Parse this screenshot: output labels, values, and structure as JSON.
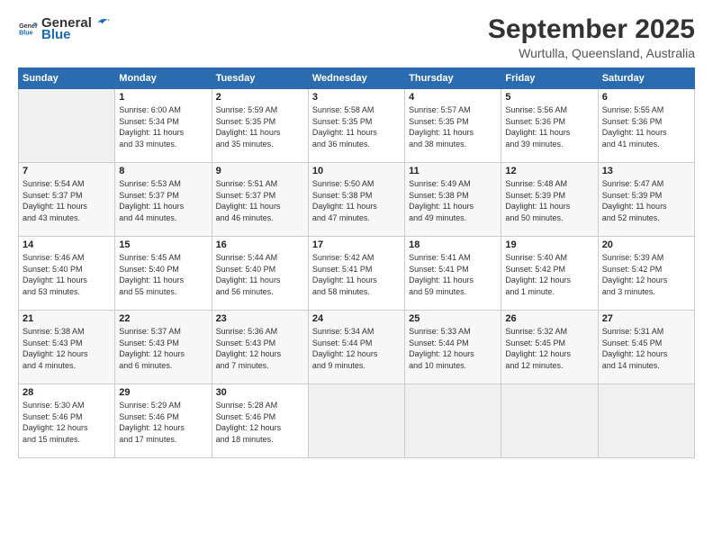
{
  "header": {
    "logo_line1": "General",
    "logo_line2": "Blue",
    "month": "September 2025",
    "location": "Wurtulla, Queensland, Australia"
  },
  "weekdays": [
    "Sunday",
    "Monday",
    "Tuesday",
    "Wednesday",
    "Thursday",
    "Friday",
    "Saturday"
  ],
  "weeks": [
    [
      {
        "day": "",
        "info": ""
      },
      {
        "day": "1",
        "info": "Sunrise: 6:00 AM\nSunset: 5:34 PM\nDaylight: 11 hours\nand 33 minutes."
      },
      {
        "day": "2",
        "info": "Sunrise: 5:59 AM\nSunset: 5:35 PM\nDaylight: 11 hours\nand 35 minutes."
      },
      {
        "day": "3",
        "info": "Sunrise: 5:58 AM\nSunset: 5:35 PM\nDaylight: 11 hours\nand 36 minutes."
      },
      {
        "day": "4",
        "info": "Sunrise: 5:57 AM\nSunset: 5:35 PM\nDaylight: 11 hours\nand 38 minutes."
      },
      {
        "day": "5",
        "info": "Sunrise: 5:56 AM\nSunset: 5:36 PM\nDaylight: 11 hours\nand 39 minutes."
      },
      {
        "day": "6",
        "info": "Sunrise: 5:55 AM\nSunset: 5:36 PM\nDaylight: 11 hours\nand 41 minutes."
      }
    ],
    [
      {
        "day": "7",
        "info": "Sunrise: 5:54 AM\nSunset: 5:37 PM\nDaylight: 11 hours\nand 43 minutes."
      },
      {
        "day": "8",
        "info": "Sunrise: 5:53 AM\nSunset: 5:37 PM\nDaylight: 11 hours\nand 44 minutes."
      },
      {
        "day": "9",
        "info": "Sunrise: 5:51 AM\nSunset: 5:37 PM\nDaylight: 11 hours\nand 46 minutes."
      },
      {
        "day": "10",
        "info": "Sunrise: 5:50 AM\nSunset: 5:38 PM\nDaylight: 11 hours\nand 47 minutes."
      },
      {
        "day": "11",
        "info": "Sunrise: 5:49 AM\nSunset: 5:38 PM\nDaylight: 11 hours\nand 49 minutes."
      },
      {
        "day": "12",
        "info": "Sunrise: 5:48 AM\nSunset: 5:39 PM\nDaylight: 11 hours\nand 50 minutes."
      },
      {
        "day": "13",
        "info": "Sunrise: 5:47 AM\nSunset: 5:39 PM\nDaylight: 11 hours\nand 52 minutes."
      }
    ],
    [
      {
        "day": "14",
        "info": "Sunrise: 5:46 AM\nSunset: 5:40 PM\nDaylight: 11 hours\nand 53 minutes."
      },
      {
        "day": "15",
        "info": "Sunrise: 5:45 AM\nSunset: 5:40 PM\nDaylight: 11 hours\nand 55 minutes."
      },
      {
        "day": "16",
        "info": "Sunrise: 5:44 AM\nSunset: 5:40 PM\nDaylight: 11 hours\nand 56 minutes."
      },
      {
        "day": "17",
        "info": "Sunrise: 5:42 AM\nSunset: 5:41 PM\nDaylight: 11 hours\nand 58 minutes."
      },
      {
        "day": "18",
        "info": "Sunrise: 5:41 AM\nSunset: 5:41 PM\nDaylight: 11 hours\nand 59 minutes."
      },
      {
        "day": "19",
        "info": "Sunrise: 5:40 AM\nSunset: 5:42 PM\nDaylight: 12 hours\nand 1 minute."
      },
      {
        "day": "20",
        "info": "Sunrise: 5:39 AM\nSunset: 5:42 PM\nDaylight: 12 hours\nand 3 minutes."
      }
    ],
    [
      {
        "day": "21",
        "info": "Sunrise: 5:38 AM\nSunset: 5:43 PM\nDaylight: 12 hours\nand 4 minutes."
      },
      {
        "day": "22",
        "info": "Sunrise: 5:37 AM\nSunset: 5:43 PM\nDaylight: 12 hours\nand 6 minutes."
      },
      {
        "day": "23",
        "info": "Sunrise: 5:36 AM\nSunset: 5:43 PM\nDaylight: 12 hours\nand 7 minutes."
      },
      {
        "day": "24",
        "info": "Sunrise: 5:34 AM\nSunset: 5:44 PM\nDaylight: 12 hours\nand 9 minutes."
      },
      {
        "day": "25",
        "info": "Sunrise: 5:33 AM\nSunset: 5:44 PM\nDaylight: 12 hours\nand 10 minutes."
      },
      {
        "day": "26",
        "info": "Sunrise: 5:32 AM\nSunset: 5:45 PM\nDaylight: 12 hours\nand 12 minutes."
      },
      {
        "day": "27",
        "info": "Sunrise: 5:31 AM\nSunset: 5:45 PM\nDaylight: 12 hours\nand 14 minutes."
      }
    ],
    [
      {
        "day": "28",
        "info": "Sunrise: 5:30 AM\nSunset: 5:46 PM\nDaylight: 12 hours\nand 15 minutes."
      },
      {
        "day": "29",
        "info": "Sunrise: 5:29 AM\nSunset: 5:46 PM\nDaylight: 12 hours\nand 17 minutes."
      },
      {
        "day": "30",
        "info": "Sunrise: 5:28 AM\nSunset: 5:46 PM\nDaylight: 12 hours\nand 18 minutes."
      },
      {
        "day": "",
        "info": ""
      },
      {
        "day": "",
        "info": ""
      },
      {
        "day": "",
        "info": ""
      },
      {
        "day": "",
        "info": ""
      }
    ]
  ]
}
